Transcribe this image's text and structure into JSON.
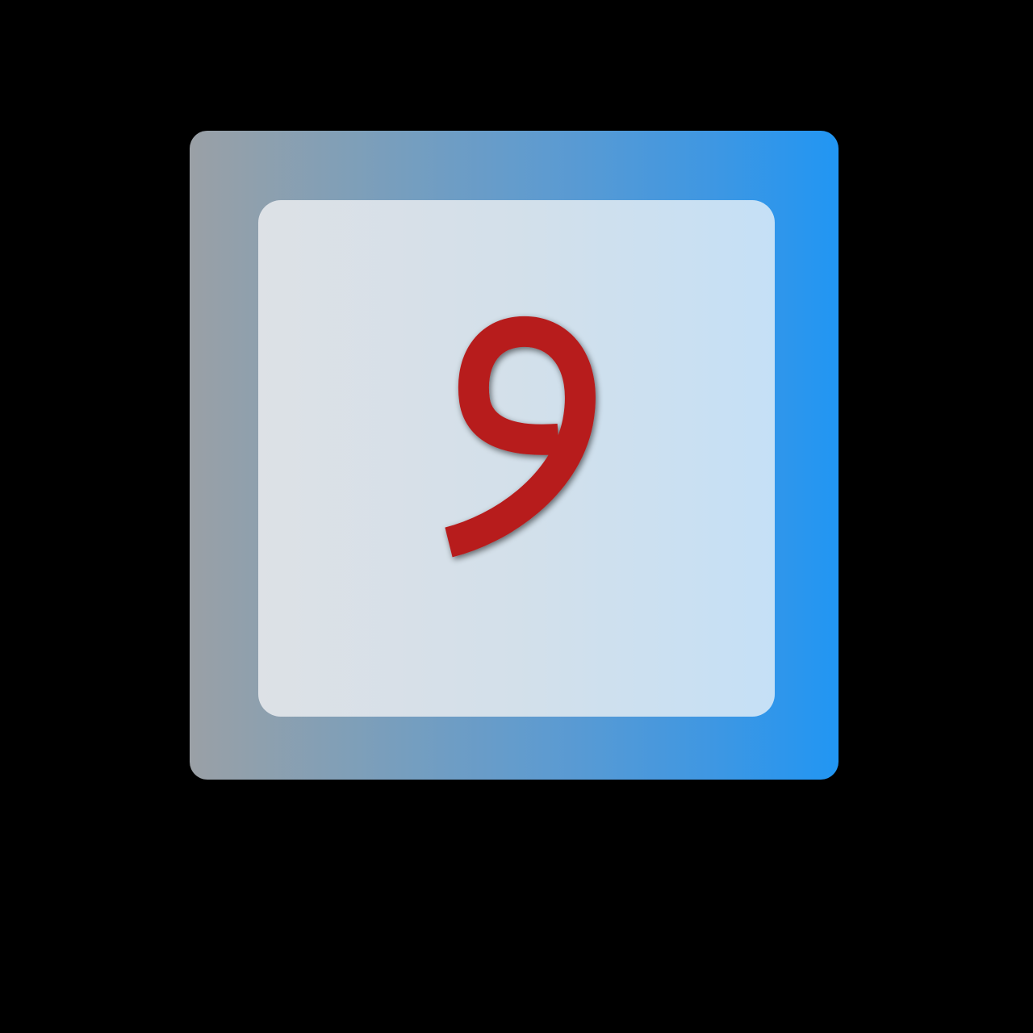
{
  "key": {
    "character": "و",
    "character_color": "#b71c1c",
    "face_color_left": "#dde1e6",
    "face_color_right": "#c5e0f6",
    "frame_color_left": "#9aa0a6",
    "frame_color_right": "#2196f3"
  },
  "background_color": "#000000"
}
